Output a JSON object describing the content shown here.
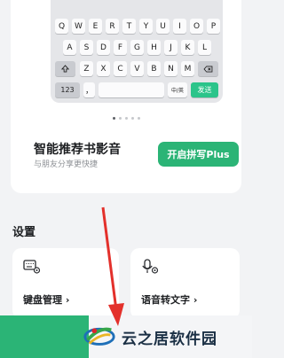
{
  "keyboard_preview": {
    "row1": [
      "Q",
      "W",
      "E",
      "R",
      "T",
      "Y",
      "U",
      "I",
      "O",
      "P"
    ],
    "row2": [
      "A",
      "S",
      "D",
      "F",
      "G",
      "H",
      "J",
      "K",
      "L"
    ],
    "row3": [
      "Z",
      "X",
      "C",
      "V",
      "B",
      "N",
      "M"
    ],
    "num_key": "123",
    "punct_key": "，",
    "lang_key": "中/英",
    "send_key": "发送"
  },
  "promo": {
    "title": "智能推荐书影音",
    "subtitle": "与朋友分享更快捷",
    "button": "开启拼写Plus"
  },
  "settings": {
    "section_title": "设置",
    "tiles": [
      {
        "label": "键盘管理",
        "icon": "keyboard-settings-icon"
      },
      {
        "label": "语音转文字",
        "icon": "microphone-settings-icon"
      }
    ],
    "chevron": "›"
  },
  "watermark": {
    "text": "云之居软件园"
  },
  "colors": {
    "accent": "#2bb476",
    "background": "#f2f3f5",
    "arrow": "#e3302b"
  }
}
